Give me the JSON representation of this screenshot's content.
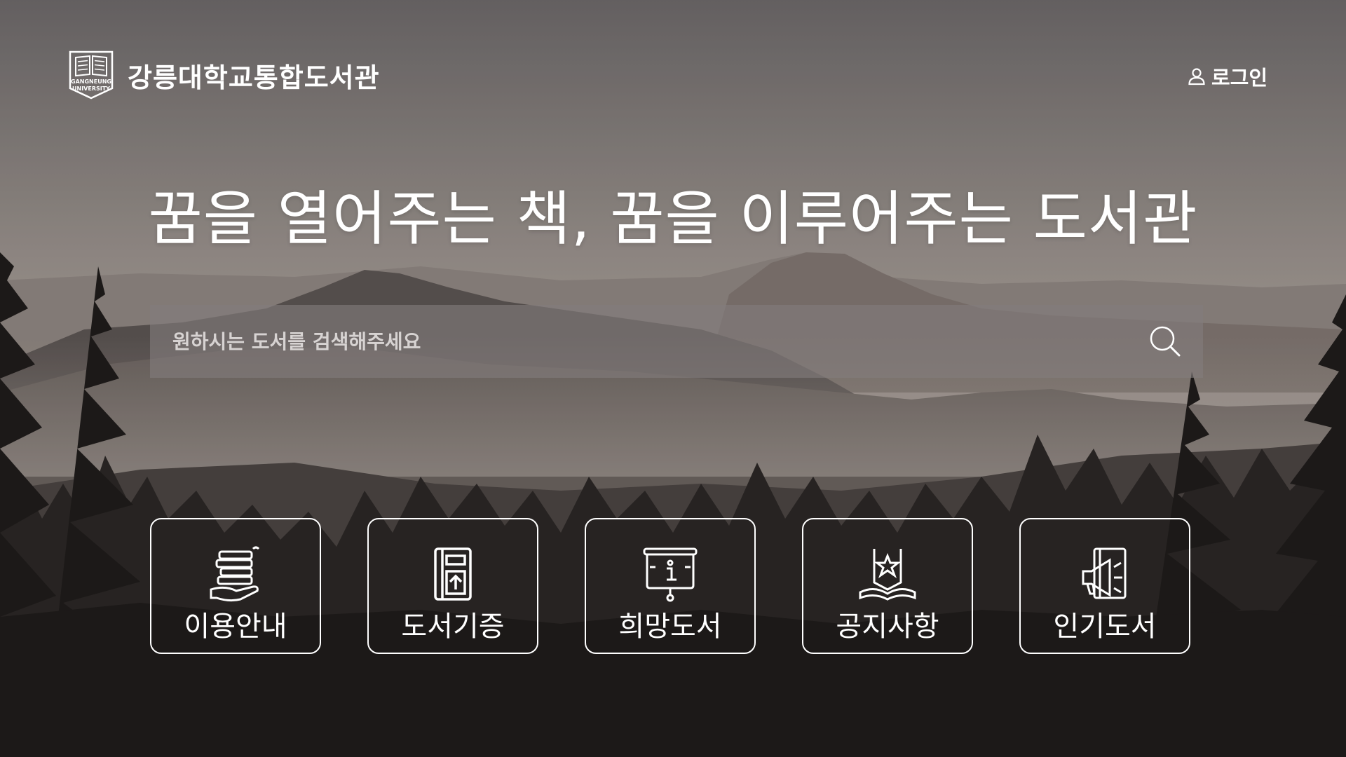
{
  "header": {
    "logo_text": "강릉대학교통합도서관",
    "logo_seal_line1": "GANGNEUNG",
    "logo_seal_line2": "UNIVERSITY",
    "login_label": "로그인",
    "login_icon": "user-icon"
  },
  "hero": {
    "title": "꿈을 열어주는 책, 꿈을 이루어주는 도서관"
  },
  "search": {
    "placeholder": "원하시는 도서를 검색해주세요",
    "value": "",
    "icon": "search-icon"
  },
  "menu": {
    "items": [
      {
        "label": "이용안내",
        "icon": "books-in-hand-icon"
      },
      {
        "label": "도서기증",
        "icon": "book-upload-icon"
      },
      {
        "label": "희망도서",
        "icon": "info-board-icon"
      },
      {
        "label": "공지사항",
        "icon": "open-book-star-icon"
      },
      {
        "label": "인기도서",
        "icon": "megaphone-book-icon"
      }
    ]
  },
  "colors": {
    "overlay_text": "#ffffff",
    "search_bg": "#827c7c",
    "sky_top": "#6f6b6c",
    "sky_mid": "#a69c96",
    "forest": "#2a2826"
  }
}
